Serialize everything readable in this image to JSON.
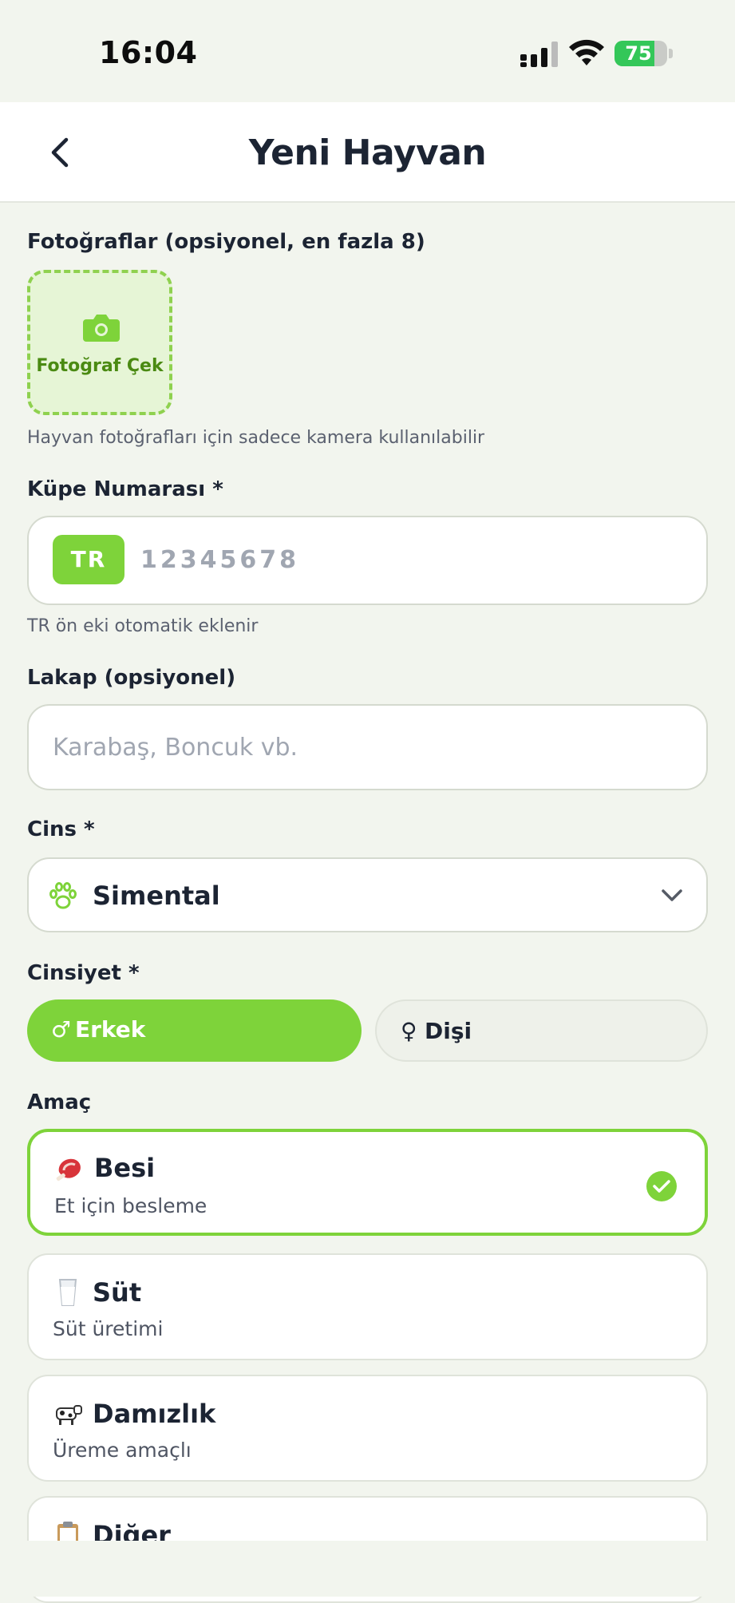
{
  "status_bar": {
    "time": "16:04",
    "battery_percent": 75,
    "battery_label": "75",
    "icons": [
      "signal-icon",
      "wifi-icon",
      "battery-icon"
    ]
  },
  "nav": {
    "title": "Yeni Hayvan",
    "back_icon": "chevron-left-icon"
  },
  "photos": {
    "label": "Fotoğraflar (opsiyonel, en fazla 8)",
    "button_label": "Fotoğraf Çek",
    "helper": "Hayvan fotoğrafları için sadece kamera kullanılabilir",
    "icon": "camera-icon"
  },
  "ear_tag": {
    "label": "Küpe Numarası *",
    "prefix": "TR",
    "placeholder": "12345678",
    "helper": "TR ön eki otomatik eklenir"
  },
  "nickname": {
    "label": "Lakap (opsiyonel)",
    "placeholder": "Karabaş, Boncuk vb."
  },
  "breed": {
    "label": "Cins *",
    "value": "Simental",
    "icon": "paw-icon"
  },
  "gender": {
    "label": "Cinsiyet *",
    "options": [
      {
        "symbol": "♂",
        "label": "Erkek",
        "selected": true
      },
      {
        "symbol": "♀",
        "label": "Dişi",
        "selected": false
      }
    ]
  },
  "purpose": {
    "label": "Amaç",
    "options": [
      {
        "emoji": "🥩",
        "title": "Besi",
        "desc": "Et için besleme",
        "selected": true
      },
      {
        "emoji": "🥛",
        "title": "Süt",
        "desc": "Süt üretimi",
        "selected": false
      },
      {
        "emoji": "🐄",
        "title": "Damızlık",
        "desc": "Üreme amaçlı",
        "selected": false
      },
      {
        "emoji": "📋",
        "title": "Diğer",
        "desc": "",
        "selected": false
      }
    ]
  },
  "colors": {
    "accent": "#7ed33a",
    "accent_dark": "#4a8a12",
    "background": "#f2f5ee",
    "text": "#1c2433"
  }
}
